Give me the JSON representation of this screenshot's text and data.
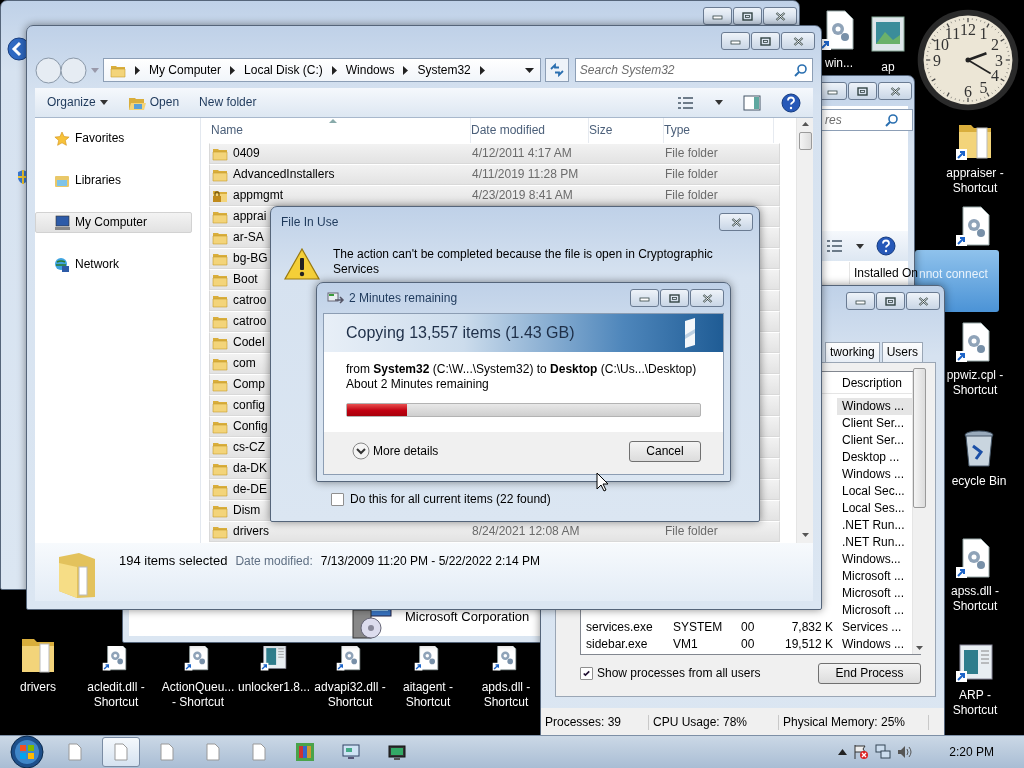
{
  "desktop_icons": [
    {
      "kind": "gear-file",
      "label": "win..."
    },
    {
      "kind": "picture",
      "label": "ap"
    },
    {
      "kind": "folder-shortcut",
      "label": "appraiser -\nShortcut"
    },
    {
      "kind": "gear-file"
    },
    {
      "kind": "gear-file",
      "label": "ppwiz.cpl -\nShortcut"
    },
    {
      "kind": "recycle",
      "label": "ecycle Bin"
    },
    {
      "kind": "gear-file",
      "label": "apss.dll -\nShortcut"
    },
    {
      "kind": "app",
      "label": "ARP -\nShortcut"
    },
    {
      "kind": "folder",
      "label": "drivers"
    },
    {
      "kind": "gear-file",
      "label": "acledit.dll -\nShortcut"
    },
    {
      "kind": "gear-file",
      "label": "ActionQueu...\n- Shortcut"
    },
    {
      "kind": "app",
      "label": "unlocker1.8..."
    },
    {
      "kind": "gear-file",
      "label": "advapi32.dll -\nShortcut"
    },
    {
      "kind": "gear-file",
      "label": "aitagent -\nShortcut"
    },
    {
      "kind": "gear-file",
      "label": "apds.dll -\nShortcut"
    }
  ],
  "clock": {
    "numerals": [
      "12",
      "1",
      "2",
      "3",
      "4",
      "5",
      "6",
      "9",
      "10",
      "11"
    ]
  },
  "notification": {
    "text": "nnot connect"
  },
  "programs_window": {
    "search_placeholder": "res",
    "column": "Installed On",
    "publisher": "Microsoft Corporation"
  },
  "task_manager": {
    "tabs": [
      {
        "label": "tworking",
        "selected": false
      },
      {
        "label": "Users",
        "selected": false
      }
    ],
    "column": "Description",
    "rows": [
      {
        "description": "Windows ...",
        "selected": true
      },
      {
        "description": "Client Ser...",
        "selected": false
      },
      {
        "description": "Client Ser...",
        "selected": false
      },
      {
        "description": "Desktop ...",
        "selected": false
      },
      {
        "description": "Windows ...",
        "selected": false
      },
      {
        "description": "Local Sec...",
        "selected": false
      },
      {
        "description": "Local Ses...",
        "selected": false
      },
      {
        "description": ".NET Run...",
        "selected": false
      },
      {
        "description": ".NET Run...",
        "selected": false
      },
      {
        "description": "Windows...",
        "selected": false
      },
      {
        "description": "Microsoft ...",
        "selected": false
      },
      {
        "description": "Microsoft ...",
        "selected": false
      },
      {
        "description": "Microsoft ...",
        "selected": false
      },
      {
        "name": "services.exe",
        "user": "SYSTEM",
        "cpu": "00",
        "memory": "7,832 K",
        "description": "Services ...",
        "selected": false
      },
      {
        "name": "sidebar.exe",
        "user": "VM1",
        "cpu": "00",
        "memory": "19,512 K",
        "description": "Windows ...",
        "selected": false
      }
    ],
    "show_all": {
      "label": "Show processes from all users",
      "checked": true
    },
    "end_process": "End Process",
    "status": [
      "Processes: 39",
      "CPU Usage: 78%",
      "Physical Memory: 25%"
    ]
  },
  "explorer": {
    "breadcrumb": [
      "My Computer",
      "Local Disk (C:)",
      "Windows",
      "System32"
    ],
    "search_placeholder": "Search System32",
    "toolbar": [
      {
        "label": "Organize",
        "kind": "menu"
      },
      {
        "label": "Open",
        "kind": "open"
      },
      {
        "label": "New folder",
        "kind": "plain"
      }
    ],
    "nav": [
      {
        "label": "Favorites",
        "kind": "star",
        "selected": false
      },
      {
        "label": "Libraries",
        "kind": "library",
        "selected": false
      },
      {
        "label": "My Computer",
        "kind": "computer",
        "selected": true
      },
      {
        "label": "Network",
        "kind": "network",
        "selected": false
      }
    ],
    "columns": [
      "Name",
      "Date modified",
      "Size",
      "Type"
    ],
    "rows": [
      {
        "kind": "folder",
        "name": "0409",
        "date": "4/12/2011 4:17 AM",
        "type": "File folder",
        "selected": true
      },
      {
        "kind": "folder",
        "name": "AdvancedInstallers",
        "date": "4/11/2019 11:28 PM",
        "type": "File folder",
        "selected": true
      },
      {
        "kind": "locked",
        "name": "appmgmt",
        "date": "4/23/2019 8:41 AM",
        "type": "File folder",
        "selected": true
      },
      {
        "kind": "folder",
        "name": "apprai",
        "selected": true
      },
      {
        "kind": "folder",
        "name": "ar-SA",
        "selected": true
      },
      {
        "kind": "folder",
        "name": "bg-BG",
        "selected": true
      },
      {
        "kind": "folder",
        "name": "Boot",
        "selected": true
      },
      {
        "kind": "folder",
        "name": "catroo",
        "selected": true
      },
      {
        "kind": "folder",
        "name": "catroo",
        "selected": true
      },
      {
        "kind": "folder",
        "name": "CodeI",
        "selected": true
      },
      {
        "kind": "folder",
        "name": "com",
        "selected": true
      },
      {
        "kind": "folder",
        "name": "Comp",
        "selected": true
      },
      {
        "kind": "folder",
        "name": "config",
        "selected": true
      },
      {
        "kind": "folder",
        "name": "Config",
        "selected": true
      },
      {
        "kind": "folder",
        "name": "cs-CZ",
        "selected": true
      },
      {
        "kind": "folder",
        "name": "da-DK",
        "selected": true
      },
      {
        "kind": "folder",
        "name": "de-DE",
        "selected": true
      },
      {
        "kind": "folder",
        "name": "Dism",
        "selected": true
      },
      {
        "kind": "folder",
        "name": "drivers",
        "date": "8/24/2021 12:08 AM",
        "type": "File folder",
        "selected": true
      }
    ],
    "status": {
      "count": "194 items selected",
      "date_label": "Date modified:",
      "date_range": "7/13/2009 11:20 PM - 5/22/2022 2:14 PM"
    }
  },
  "file_in_use": {
    "title": "File In Use",
    "message": "The action can't be completed because the file is open in Cryptographic Services",
    "checkbox": {
      "label": "Do this for all current items (22 found)",
      "checked": false
    }
  },
  "copy_dialog": {
    "title": "2 Minutes remaining",
    "heading": "Copying 13,557 items (1.43 GB)",
    "detail": "from **System32** (C:\\W...\\System32) to **Desktop** (C:\\Us...\\Desktop)",
    "remaining": "About 2 Minutes remaining",
    "level": 0.17,
    "more": "More details",
    "cancel": "Cancel"
  },
  "taskbar": {
    "buttons": [
      {
        "kind": "document",
        "selected": false
      },
      {
        "kind": "document",
        "selected": true
      },
      {
        "kind": "document",
        "selected": false
      },
      {
        "kind": "document",
        "selected": false
      },
      {
        "kind": "document",
        "selected": false
      },
      {
        "kind": "archive",
        "selected": false
      },
      {
        "kind": "remote",
        "selected": false
      },
      {
        "kind": "monitor",
        "selected": false
      }
    ],
    "time": "2:20 PM"
  }
}
